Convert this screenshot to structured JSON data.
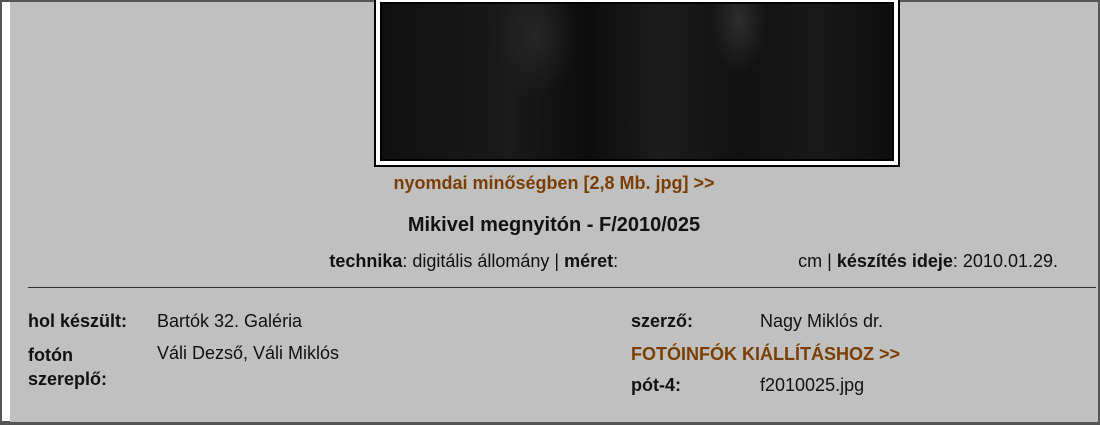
{
  "photo": {
    "print_link": "nyomdai minőségben [2,8 Mb. jpg] >>"
  },
  "title": "Mikivel megnyitón - F/2010/025",
  "meta": {
    "technika_label": "technika",
    "technika_value": ": digitális állomány | ",
    "meret_label": "méret",
    "meret_value": ":",
    "cm_sep": "cm | ",
    "keszites_label": "készítés ideje",
    "keszites_value": ": 2010.01.29."
  },
  "details": {
    "hol_label": "hol készült:",
    "hol_value": "Bartók 32. Galéria",
    "foton_label": "fotón szereplő:",
    "foton_value": "Váli Dezső, Váli Miklós",
    "szerzo_label": "szerző:",
    "szerzo_value": "Nagy Miklós dr.",
    "fotoinfo_link": "FOTÓINFÓK KIÁLLÍTÁSHOZ >>",
    "pot_label": "pót-4:",
    "pot_value": "f2010025.jpg"
  },
  "colors": {
    "link": "#7a3e00",
    "panel": "#c0c0c0"
  }
}
